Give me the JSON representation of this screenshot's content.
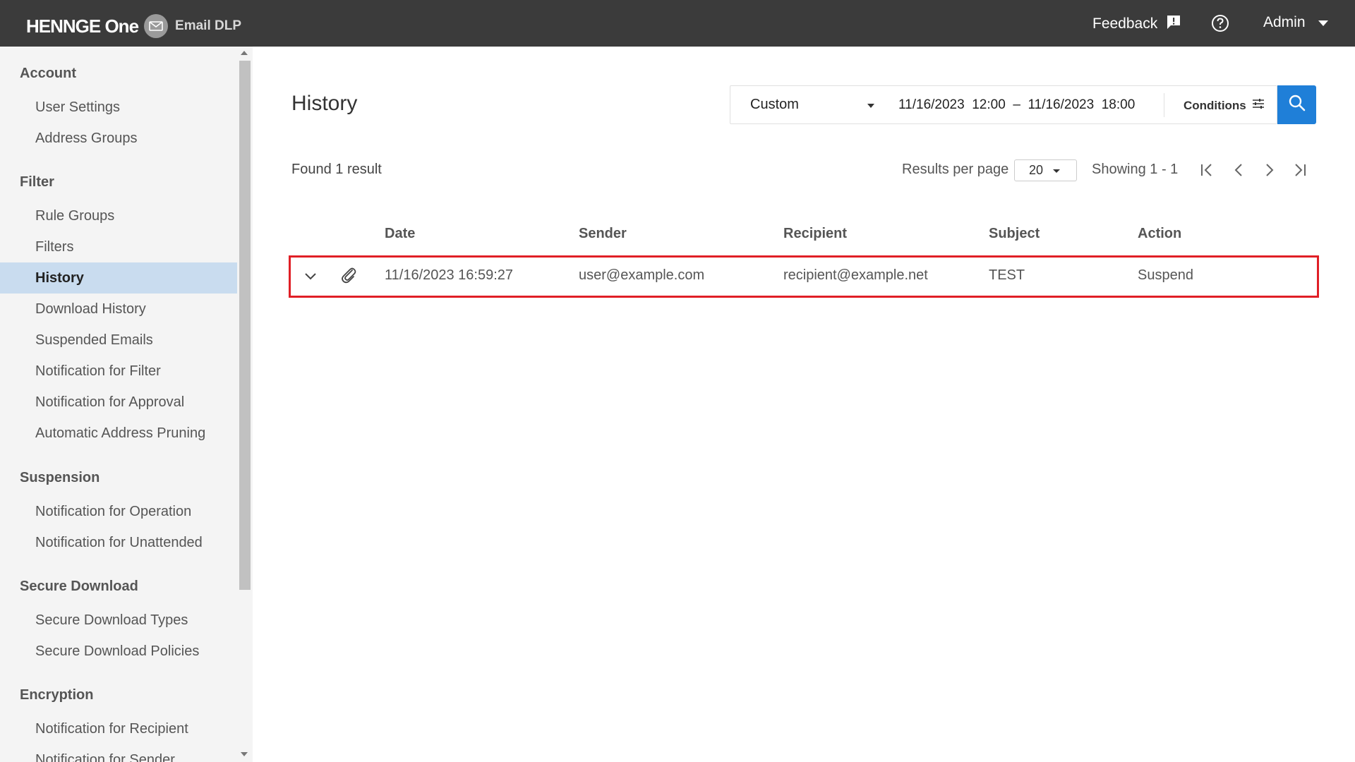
{
  "topbar": {
    "brand": "HENNGE One",
    "product": "Email DLP",
    "feedback": "Feedback",
    "user": "Admin"
  },
  "sidebar": {
    "sections": [
      {
        "title": "Account",
        "items": [
          "User Settings",
          "Address Groups"
        ]
      },
      {
        "title": "Filter",
        "items": [
          "Rule Groups",
          "Filters",
          "History",
          "Download History",
          "Suspended Emails",
          "Notification for Filter",
          "Notification for Approval",
          "Automatic Address Pruning"
        ]
      },
      {
        "title": "Suspension",
        "items": [
          "Notification for Operation",
          "Notification for Unattended"
        ]
      },
      {
        "title": "Secure Download",
        "items": [
          "Secure Download Types",
          "Secure Download Policies"
        ]
      },
      {
        "title": "Encryption",
        "items": [
          "Notification for Recipient",
          "Notification for Sender"
        ]
      }
    ],
    "active_item": "History"
  },
  "main": {
    "title": "History",
    "filter": {
      "range_option": "Custom",
      "range_text": "11/16/2023  12:00  –  11/16/2023  18:00",
      "conditions_label": "Conditions"
    },
    "found": "Found 1 result",
    "results_per_page_label": "Results per page",
    "results_per_page_value": "20",
    "showing": "Showing 1 - 1",
    "columns": [
      "Date",
      "Sender",
      "Recipient",
      "Subject",
      "Action"
    ],
    "rows": [
      {
        "date": "11/16/2023 16:59:27",
        "sender": "user@example.com",
        "recipient": "recipient@example.net",
        "subject": "TEST",
        "action": "Suspend"
      }
    ]
  },
  "colors": {
    "topbar": "#3b3b3b",
    "accent": "#1f7fd8",
    "highlight_border": "#e01f26",
    "active_nav": "#c9dcef"
  }
}
